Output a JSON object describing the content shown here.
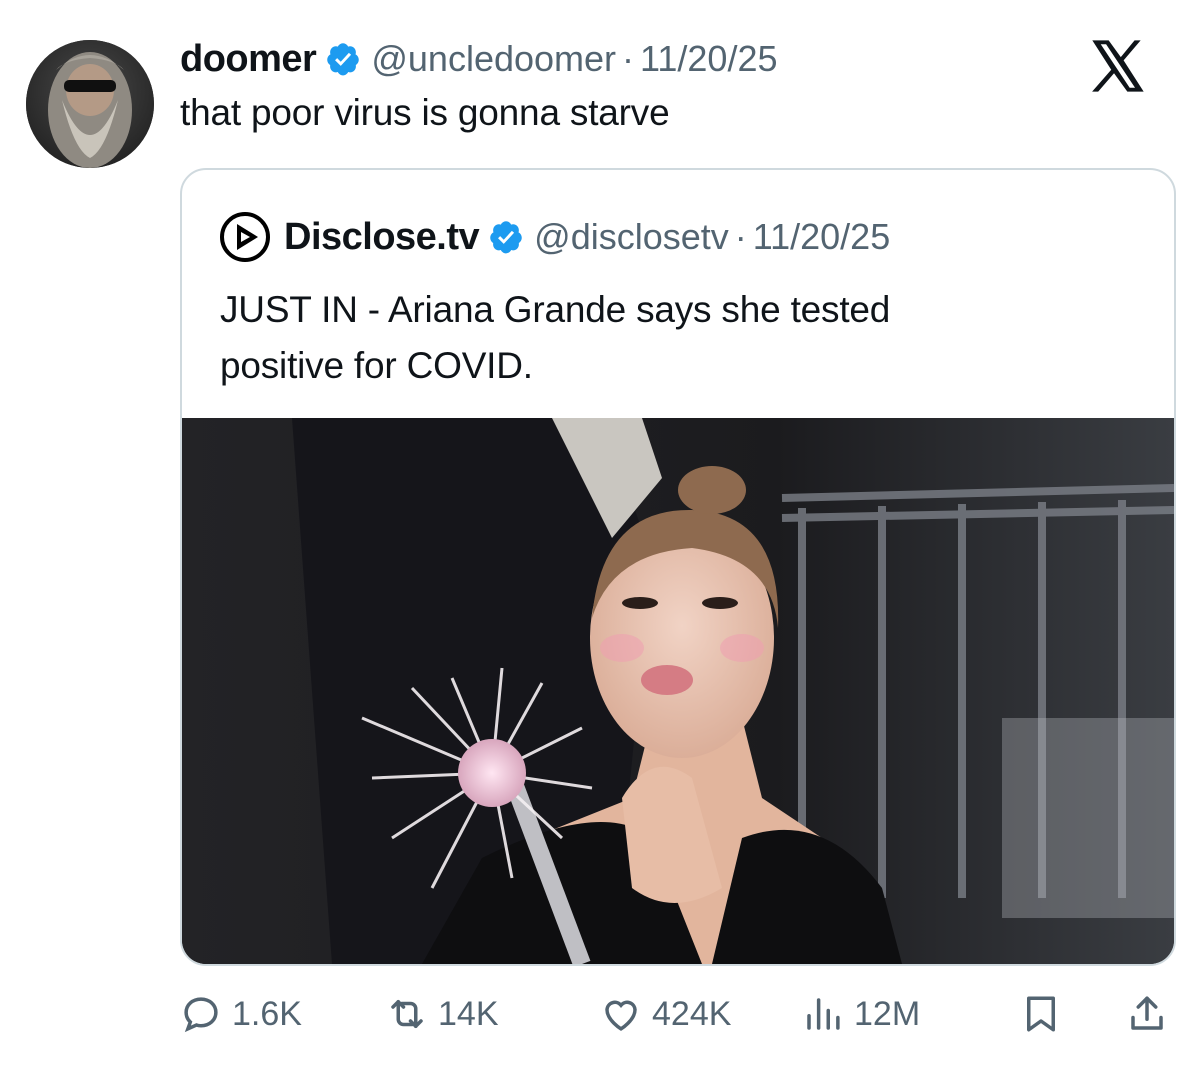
{
  "tweet": {
    "display_name": "doomer",
    "handle": "@uncledoomer",
    "separator": "·",
    "date": "11/20/25",
    "text": "that poor virus is gonna starve"
  },
  "quoted": {
    "display_name": "Disclose.tv",
    "handle": "@disclosetv",
    "separator": "·",
    "date": "11/20/25",
    "text_line1": "JUST IN - Ariana Grande says she tested",
    "text_line2": "positive for COVID."
  },
  "actions": {
    "replies": "1.6K",
    "reposts": "14K",
    "likes": "424K",
    "views": "12M"
  },
  "icons": {
    "verified": "verified-badge-icon",
    "x_logo": "x-logo-icon",
    "reply": "reply-icon",
    "repost": "repost-icon",
    "like": "like-icon",
    "views": "views-icon",
    "bookmark": "bookmark-icon",
    "share": "share-icon"
  },
  "colors": {
    "text": "#0f1419",
    "secondary": "#536471",
    "verified": "#1d9bf0",
    "border": "#cfd9de"
  }
}
